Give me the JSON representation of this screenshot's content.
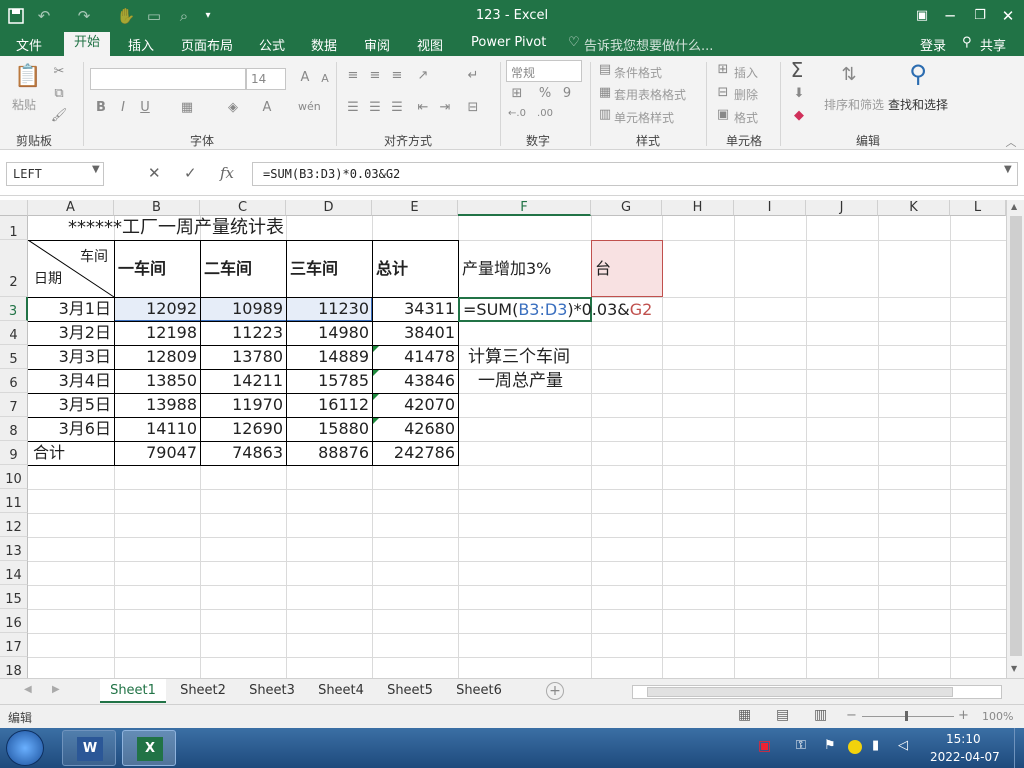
{
  "window": {
    "title": "123 - Excel"
  },
  "tabs": [
    "文件",
    "开始",
    "插入",
    "页面布局",
    "公式",
    "数据",
    "审阅",
    "视图",
    "Power Pivot"
  ],
  "active_tab": "开始",
  "tell_me": "告诉我您想要做什么...",
  "account": {
    "login": "登录",
    "share": "共享"
  },
  "ribbon": {
    "clipboard": {
      "label": "剪贴板",
      "paste": "粘贴"
    },
    "font": {
      "label": "字体",
      "size": "14",
      "bold": "B",
      "italic": "I",
      "underline": "U",
      "grow": "A",
      "shrink": "A"
    },
    "alignment": {
      "label": "对齐方式"
    },
    "number": {
      "label": "数字",
      "format": "常规",
      "percent": "%",
      "comma": "9"
    },
    "styles": {
      "label": "样式",
      "conditional": "条件格式",
      "table": "套用表格格式",
      "cell": "单元格样式"
    },
    "cells": {
      "label": "单元格",
      "insert": "插入",
      "delete": "删除",
      "format": "格式"
    },
    "editing": {
      "label": "编辑",
      "sort": "排序和筛选",
      "find": "查找和选择"
    }
  },
  "formula_bar": {
    "name_box": "LEFT",
    "formula": "=SUM(B3:D3)*0.03&G2"
  },
  "columns": [
    "A",
    "B",
    "C",
    "D",
    "E",
    "F",
    "G",
    "H",
    "I",
    "J",
    "K",
    "L"
  ],
  "rows": [
    "1",
    "2",
    "3",
    "4",
    "5",
    "6",
    "7",
    "8",
    "9",
    "10",
    "11",
    "12",
    "13",
    "14",
    "15",
    "16",
    "17",
    "18"
  ],
  "sheet": {
    "title": "******工厂一周产量统计表",
    "diag_top": "车间",
    "diag_bottom": "日期",
    "headers": [
      "一车间",
      "二车间",
      "三车间",
      "总计"
    ],
    "f2": "产量增加3%",
    "g2": "台",
    "data": [
      [
        "3月1日",
        "12092",
        "10989",
        "11230",
        "34311"
      ],
      [
        "3月2日",
        "12198",
        "11223",
        "14980",
        "38401"
      ],
      [
        "3月3日",
        "12809",
        "13780",
        "14889",
        "41478"
      ],
      [
        "3月4日",
        "13850",
        "14211",
        "15785",
        "43846"
      ],
      [
        "3月5日",
        "13988",
        "11970",
        "16112",
        "42070"
      ],
      [
        "3月6日",
        "14110",
        "12690",
        "15880",
        "42680"
      ]
    ],
    "total": [
      "合计",
      "79047",
      "74863",
      "88876",
      "242786"
    ],
    "edit": {
      "p1": "=SUM(",
      "p2": "B3:D3",
      "p3": ")*0.03&",
      "p4": "G2"
    },
    "note": [
      "计算三个车间",
      "一周总产量"
    ]
  },
  "sheets": [
    "Sheet1",
    "Sheet2",
    "Sheet3",
    "Sheet4",
    "Sheet5",
    "Sheet6"
  ],
  "active_sheet": "Sheet1",
  "status": {
    "mode": "编辑",
    "zoom": "100%"
  },
  "taskbar": {
    "time": "15:10",
    "date": "2022-04-07"
  },
  "colors": {
    "excel_green": "#217346",
    "ref_blue": "#3a6fbf",
    "ref_red": "#c0504d"
  }
}
